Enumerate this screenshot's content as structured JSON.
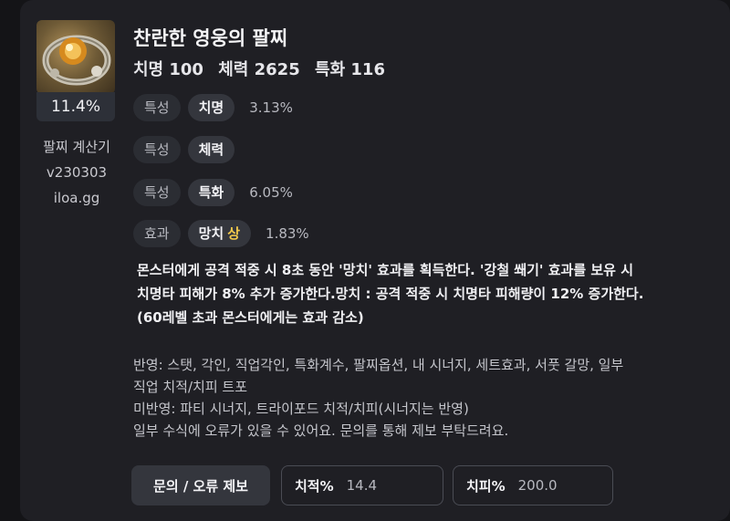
{
  "item": {
    "icon": "bracelet-icon",
    "name": "찬란한 영웅의 팔찌",
    "percent": "11.4%",
    "stats": [
      "치명 100",
      "체력 2625",
      "특화 116"
    ]
  },
  "calculator": {
    "title": "팔찌 계산기",
    "version": "v230303",
    "site": "iloa.gg"
  },
  "properties": [
    {
      "type": "특성",
      "name": "치명",
      "grade": "",
      "value": "3.13%"
    },
    {
      "type": "특성",
      "name": "체력",
      "grade": "",
      "value": ""
    },
    {
      "type": "특성",
      "name": "특화",
      "grade": "",
      "value": "6.05%"
    },
    {
      "type": "효과",
      "name": "망치",
      "grade": "상",
      "value": "1.83%"
    }
  ],
  "effect_description": [
    "몬스터에게 공격 적중 시 8초 동안 '망치' 효과를 획득한다. '강철 쐐기' 효과를 보유 시",
    "치명타 피해가 8% 추가 증가한다.망치 : 공격 적중 시 치명타 피해량이 12% 증가한다.",
    "(60레벨 초과 몬스터에게는 효과 감소)"
  ],
  "notes": [
    "반영: 스탯, 각인, 직업각인, 특화계수, 팔찌옵션, 내 시너지, 세트효과, 서풋 갈망, 일부",
    "직업 치적/치피 트포",
    "미반영: 파티 시너지, 트라이포드 치적/치피(시너지는 반영)",
    "일부 수식에 오류가 있을 수 있어요. 문의를 통해 제보 부탁드려요."
  ],
  "controls": {
    "report_button": "문의 / 오류 제보",
    "crit_rate_label": "치적%",
    "crit_rate_value": "14.4",
    "crit_dmg_label": "치피%",
    "crit_dmg_value": "200.0"
  },
  "colors": {
    "background": "#141417",
    "card": "#1f1f24",
    "pill": "#34363d",
    "grade_accent": "#f2c94c"
  }
}
